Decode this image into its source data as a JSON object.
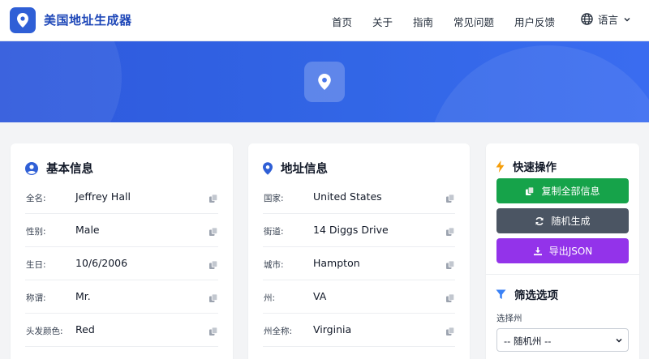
{
  "header": {
    "brand": "美国地址生成器",
    "nav": [
      "首页",
      "关于",
      "指南",
      "常见问题",
      "用户反馈"
    ],
    "language_label": "语言"
  },
  "basic_info": {
    "title": "基本信息",
    "rows": [
      {
        "label": "全名:",
        "value": "Jeffrey Hall"
      },
      {
        "label": "性别:",
        "value": "Male"
      },
      {
        "label": "生日:",
        "value": "10/6/2006"
      },
      {
        "label": "称谓:",
        "value": "Mr."
      },
      {
        "label": "头发颜色:",
        "value": "Red"
      }
    ]
  },
  "address_info": {
    "title": "地址信息",
    "rows": [
      {
        "label": "国家:",
        "value": "United States"
      },
      {
        "label": "街道:",
        "value": "14 Diggs Drive"
      },
      {
        "label": "城市:",
        "value": "Hampton"
      },
      {
        "label": "州:",
        "value": "VA"
      },
      {
        "label": "州全称:",
        "value": "Virginia"
      }
    ]
  },
  "quick_actions": {
    "title": "快速操作",
    "copy_all": "复制全部信息",
    "random": "随机生成",
    "export_json": "导出JSON"
  },
  "filter": {
    "title": "筛选选项",
    "state_label": "选择州",
    "state_selected": "-- 随机州 --"
  },
  "colors": {
    "primary": "#2f5fd6",
    "green": "#16a34a",
    "gray": "#4b5563",
    "purple": "#9333ea"
  }
}
